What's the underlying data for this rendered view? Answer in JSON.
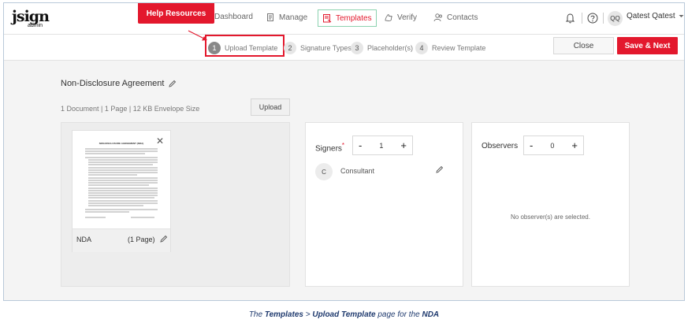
{
  "logo": {
    "brand": "jsign",
    "sub": "admin"
  },
  "help_button": "Help Resources",
  "nav": {
    "dashboard": "Dashboard",
    "manage": "Manage",
    "templates": "Templates",
    "verify": "Verify",
    "contacts": "Contacts"
  },
  "user": {
    "initials": "QQ",
    "name": "Qatest Qatest"
  },
  "steps": [
    {
      "num": "1",
      "label": "Upload Template"
    },
    {
      "num": "2",
      "label": "Signature Types"
    },
    {
      "num": "3",
      "label": "Placeholder(s)"
    },
    {
      "num": "4",
      "label": "Review Template"
    }
  ],
  "actions": {
    "close": "Close",
    "save_next": "Save & Next"
  },
  "document": {
    "title": "Non-Disclosure Agreement",
    "meta": "1 Document | 1 Page | 12 KB Envelope Size",
    "upload": "Upload",
    "card_name": "NDA",
    "card_pages": "(1 Page)",
    "thumb_heading": "NON-DISCLOSURE AGREEMENT (NDA)"
  },
  "signers": {
    "label": "Signers",
    "required_mark": "*",
    "minus": "-",
    "plus": "+",
    "count": "1",
    "list": [
      {
        "initial": "C",
        "name": "Consultant"
      }
    ]
  },
  "observers": {
    "label": "Observers",
    "minus": "-",
    "plus": "+",
    "count": "0",
    "empty": "No observer(s) are selected."
  },
  "caption": {
    "pre": "The ",
    "templates": "Templates",
    "sep": " > ",
    "upload": "Upload Template",
    "mid": " page for the ",
    "nda": "NDA"
  },
  "colors": {
    "accent": "#e3182d",
    "highlight_border": "#8cd2b0",
    "caption": "#1f3a6e"
  }
}
